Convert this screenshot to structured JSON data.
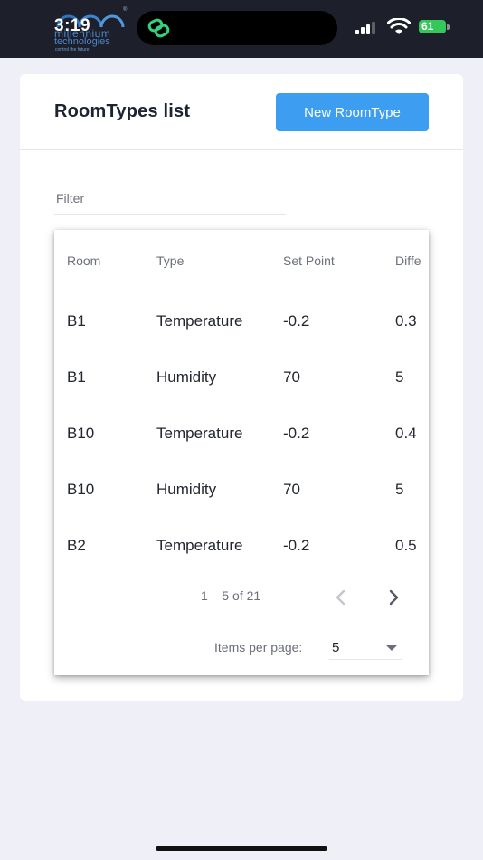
{
  "status_bar": {
    "time": "3:19",
    "battery": "61",
    "logo": {
      "line1": "millennium",
      "line2": "technologies",
      "line3": "control the future",
      "mark": "®"
    }
  },
  "header": {
    "title": "RoomTypes list",
    "new_button_label": "New RoomType"
  },
  "filter": {
    "placeholder": "Filter",
    "value": ""
  },
  "table": {
    "columns": [
      "Room",
      "Type",
      "Set Point",
      "Diffe"
    ],
    "rows": [
      [
        "B1",
        "Temperature",
        "-0.2",
        "0.3"
      ],
      [
        "B1",
        "Humidity",
        "70",
        "5"
      ],
      [
        "B10",
        "Temperature",
        "-0.2",
        "0.4"
      ],
      [
        "B10",
        "Humidity",
        "70",
        "5"
      ],
      [
        "B2",
        "Temperature",
        "-0.2",
        "0.5"
      ]
    ]
  },
  "paginator": {
    "range": "1 – 5 of 21",
    "items_per_page_label": "Items per page:",
    "items_per_page": "5"
  },
  "colors": {
    "primary": "#3d9df0",
    "status_bar_bg": "#1d1f2b",
    "page_bg": "#eff0f7",
    "battery": "#34c759"
  },
  "icons": [
    "linked-app-icon",
    "signal-icon",
    "wifi-icon",
    "battery-icon",
    "chevron-left-icon",
    "chevron-right-icon",
    "dropdown-arrow-icon"
  ]
}
